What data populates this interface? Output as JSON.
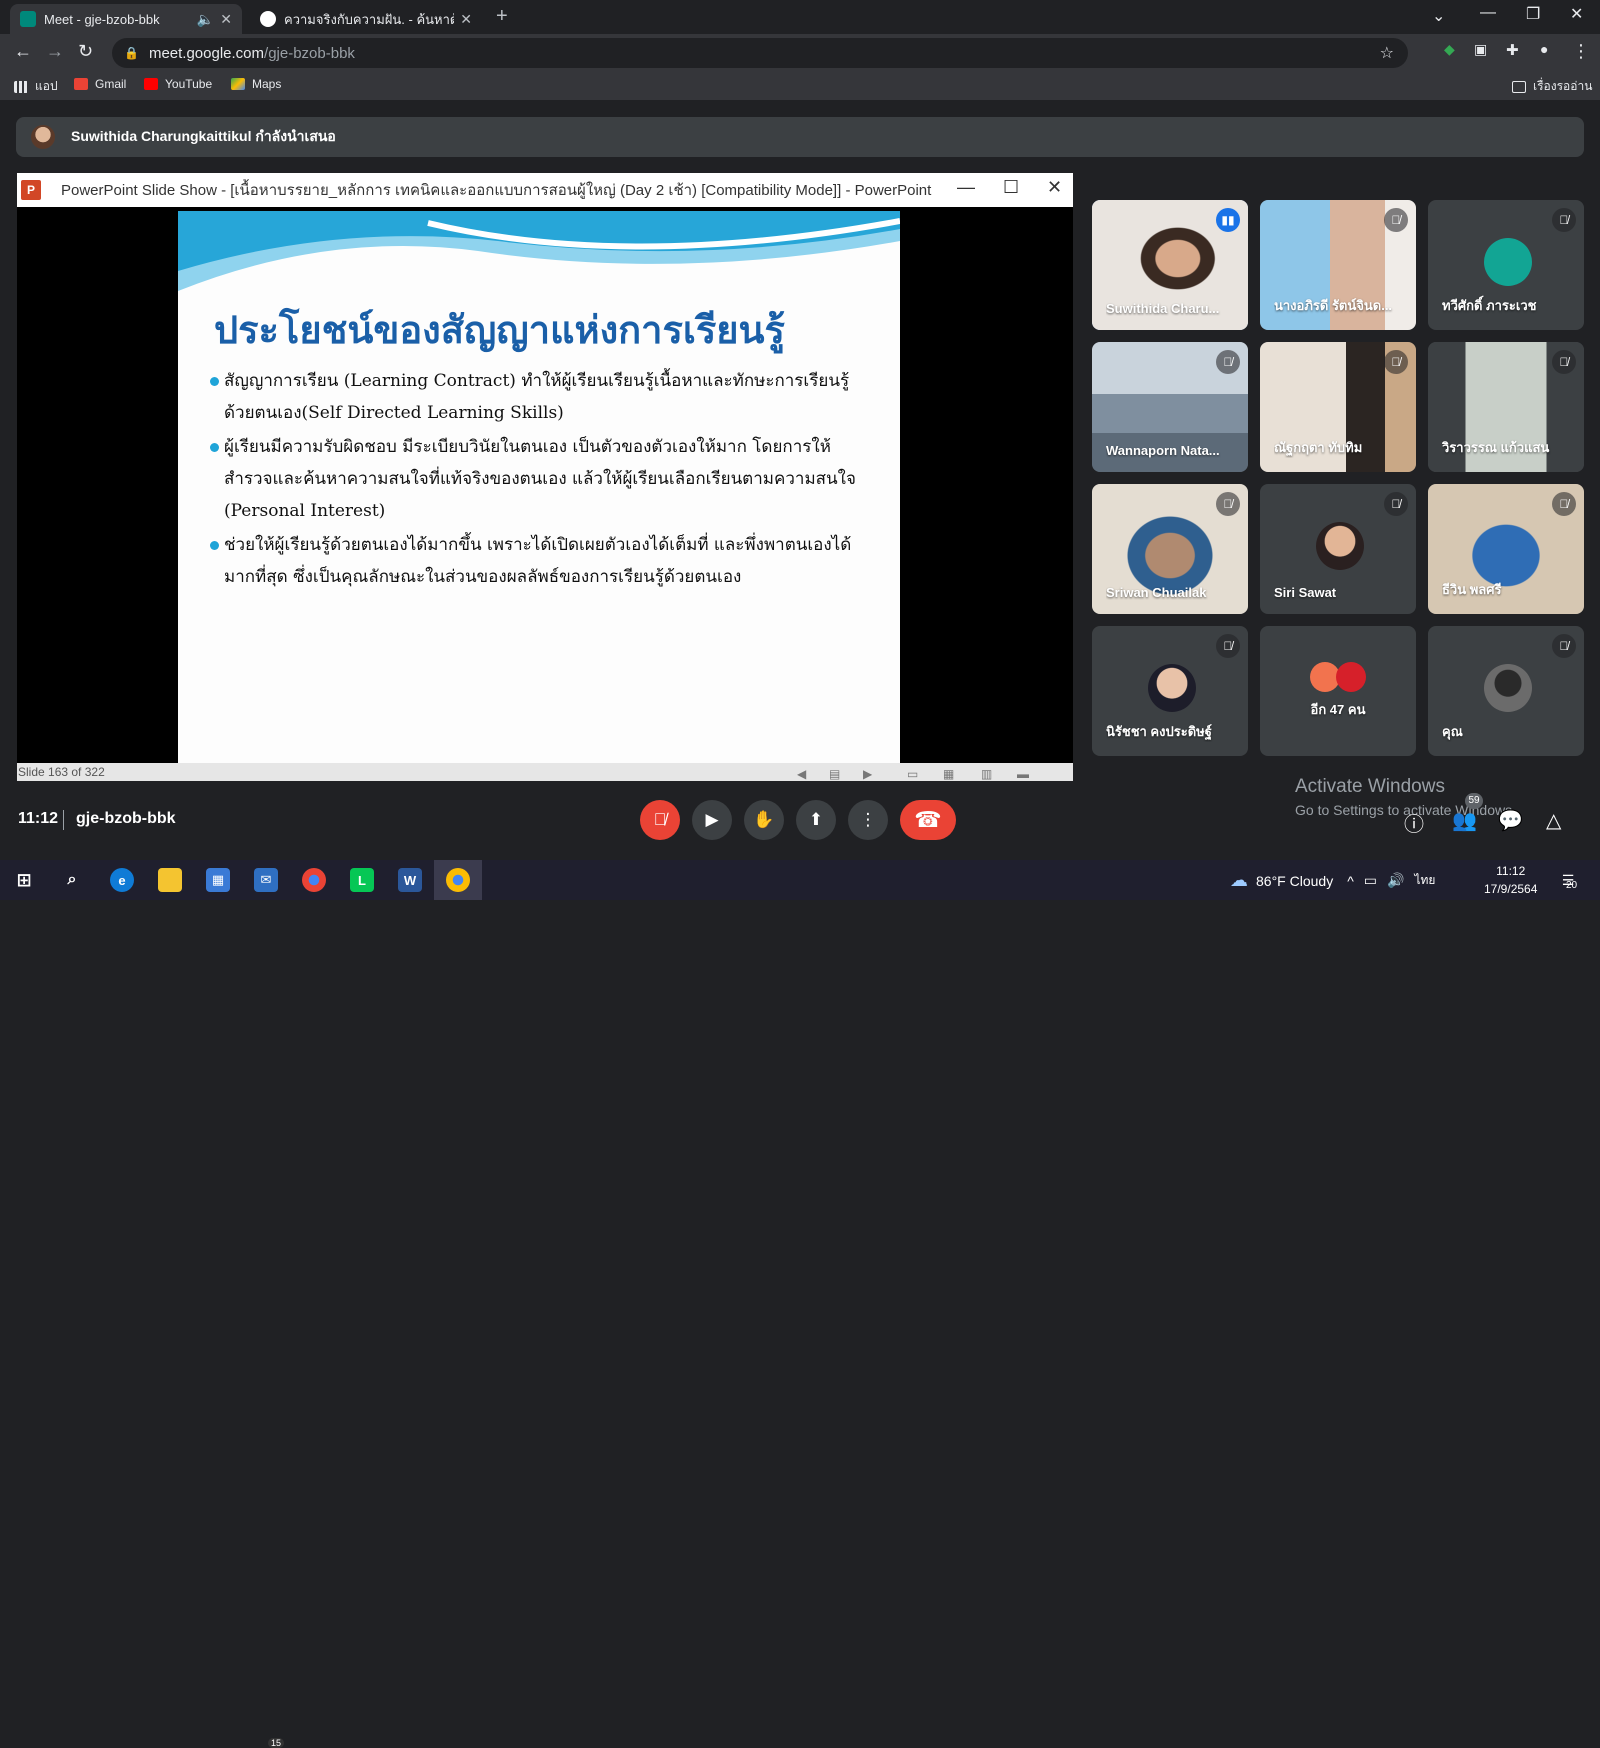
{
  "browser": {
    "tabs": [
      {
        "title": "Meet - gje-bzob-bbk",
        "active": true
      },
      {
        "title": "ความจริงกับความฝัน. - ค้นหาด้วย Goo",
        "active": false
      }
    ],
    "url_host": "meet.google.com",
    "url_path": "/gje-bzob-bbk",
    "bookmarks": [
      "แอป",
      "Gmail",
      "YouTube",
      "Maps"
    ],
    "reading_list": "เรื่องรออ่าน"
  },
  "meet": {
    "presenting_banner": "Suwithida Charungkaittikul กำลังนำเสนอ",
    "time": "11:12",
    "meeting_code": "gje-bzob-bbk",
    "participant_count": "59",
    "participants": [
      {
        "name": "Suwithida Charu...",
        "speaking": true
      },
      {
        "name": "นางอภิรดี รัตน์จินด...",
        "speaking": false
      },
      {
        "name": "ทวีศักดิ์ ภาระเวช",
        "speaking": false
      },
      {
        "name": "Wannaporn Nata...",
        "speaking": false
      },
      {
        "name": "ณัฐกฤตา ทับทิม",
        "speaking": false
      },
      {
        "name": "วิราวรรณ แก้วแสน",
        "speaking": false
      },
      {
        "name": "Sriwan Chuailak",
        "speaking": false
      },
      {
        "name": "Siri Sawat",
        "speaking": false
      },
      {
        "name": "ธีวิน พลศรี",
        "speaking": false
      },
      {
        "name": "นิรัชชา คงประดิษฐ์",
        "speaking": false
      },
      {
        "name": "อีก 47 คน",
        "speaking": false
      },
      {
        "name": "คุณ",
        "speaking": false
      }
    ]
  },
  "powerpoint": {
    "window_title": "PowerPoint Slide Show - [เนื้อหาบรรยาย_หลักการ เทคนิคและออกแบบการสอนผู้ใหญ่ (Day 2 เช้า) [Compatibility Mode]] - PowerPoint",
    "status": "Slide 163 of 322",
    "slide": {
      "title": "ประโยชน์ของสัญญาแห่งการเรียนรู้",
      "bullets": [
        "สัญญาการเรียน (Learning Contract) ทำให้ผู้เรียนเรียนรู้เนื้อหาและทักษะการเรียนรู้ด้วยตนเอง(Self Directed Learning Skills)",
        "ผู้เรียนมีความรับผิดชอบ มีระเบียบวินัยในตนเอง เป็นตัวของตัวเองให้มาก โดยการให้สำรวจและค้นหาความสนใจที่แท้จริงของตนเอง แล้วให้ผู้เรียนเลือกเรียนตามความสนใจ (Personal Interest)",
        "ช่วยให้ผู้เรียนรู้ด้วยตนเองได้มากขึ้น เพราะได้เปิดเผยตัวเองได้เต็มที่ และพึ่งพาตนเองได้มากที่สุด ซึ่งเป็นคุณลักษณะในส่วนของผลลัพธ์ของการเรียนรู้ด้วยตนเอง"
      ]
    }
  },
  "watermark": {
    "line1": "Activate Windows",
    "line2": "Go to Settings to activate Windows."
  },
  "taskbar": {
    "weather": "86°F Cloudy",
    "lang": "ไทย",
    "time": "11:12",
    "date": "17/9/2564",
    "mail_badge": "15",
    "notif_badge": "20"
  },
  "colors": {
    "meet_bg": "#202124",
    "tile_bg": "#3c4043",
    "end_call": "#ea4335",
    "slide_title": "#1a5fa8",
    "bullet": "#1fa4d8"
  }
}
